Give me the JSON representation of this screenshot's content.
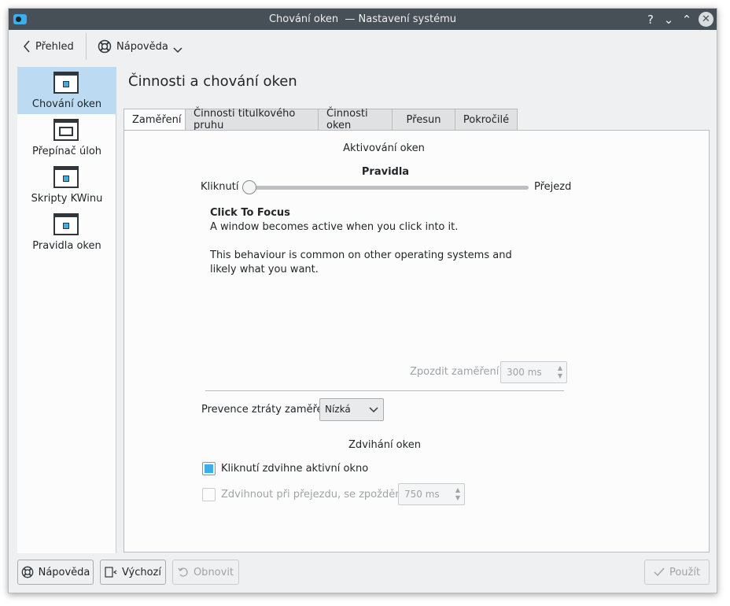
{
  "window": {
    "title": "Chování oken  — Nastavení systému"
  },
  "titlebar": {
    "help_glyph": "?",
    "minimize_glyph": "⌄",
    "maximize_glyph": "⌃",
    "close_glyph": "✕"
  },
  "toolbar": {
    "back_label": "Přehled",
    "help_label": "Nápověda"
  },
  "sidebar": {
    "items": [
      {
        "label": "Chování oken",
        "icon": "window-icon",
        "active": true
      },
      {
        "label": "Přepínač úloh",
        "icon": "task-switcher-icon",
        "active": false
      },
      {
        "label": "Skripty KWinu",
        "icon": "window-icon",
        "active": false
      },
      {
        "label": "Pravidla oken",
        "icon": "window-icon",
        "active": false
      }
    ]
  },
  "page": {
    "title": "Činnosti a chování oken"
  },
  "tabs": [
    {
      "label": "Zaměření",
      "active": true
    },
    {
      "label": "Činnosti titulkového pruhu",
      "active": false
    },
    {
      "label": "Činnosti oken",
      "active": false
    },
    {
      "label": "Přesun",
      "active": false
    },
    {
      "label": "Pokročilé",
      "active": false
    }
  ],
  "focus": {
    "section_title": "Aktivování oken",
    "policy_title": "Pravidla",
    "slider_left": "Kliknutí",
    "slider_right": "Přejezd",
    "slider_value": 0,
    "desc_title": "Click To Focus",
    "desc_line1": "A window becomes active when you click into it.",
    "desc_line2": "This behaviour is common on other operating systems and",
    "desc_line3": "likely what you want.",
    "delay_label": "Zpozdit zaměření o",
    "delay_value": "300 ms",
    "prevention_label": "Prevence ztráty zaměření",
    "prevention_value": "Nízká"
  },
  "raise": {
    "section_title": "Zdvihání oken",
    "click_raise_label": "Kliknutí zdvihne aktivní okno",
    "click_raise_checked": true,
    "hover_raise_label": "Zdvihnout při přejezdu, se zpožděním",
    "hover_raise_checked": false,
    "hover_delay_value": "750 ms"
  },
  "footer": {
    "help_label": "Nápověda",
    "defaults_label": "Výchozí",
    "reset_label": "Obnovit",
    "apply_label": "Použít"
  },
  "colors": {
    "accent": "#3daee9",
    "titlebar": "#475057",
    "selection": "#bcdbf3"
  }
}
